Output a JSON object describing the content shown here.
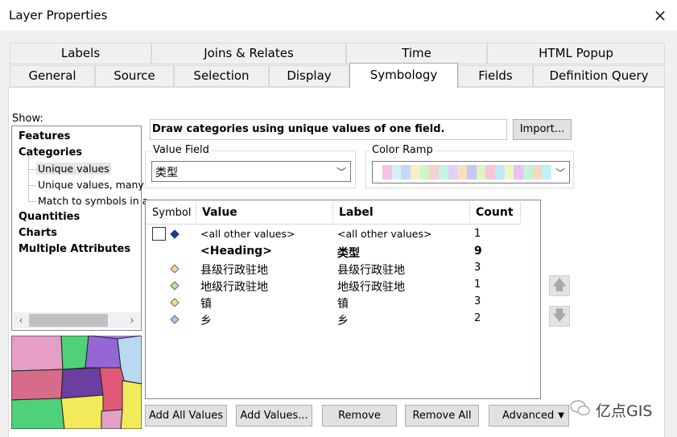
{
  "window": {
    "title": "Layer Properties",
    "close": "×"
  },
  "tabs_row1": [
    "Labels",
    "Joins & Relates",
    "Time",
    "HTML Popup"
  ],
  "tabs_row2": [
    "General",
    "Source",
    "Selection",
    "Display",
    "Symbology",
    "Fields",
    "Definition Query"
  ],
  "active_tab": "Symbology",
  "show": {
    "label": "Show:",
    "items": [
      {
        "text": "Features",
        "level": 0
      },
      {
        "text": "Categories",
        "level": 0
      },
      {
        "text": "Unique values",
        "level": 1,
        "selected": true
      },
      {
        "text": "Unique values, many",
        "level": 1
      },
      {
        "text": "Match to symbols in a",
        "level": 1
      },
      {
        "text": "Quantities",
        "level": 0
      },
      {
        "text": "Charts",
        "level": 0
      },
      {
        "text": "Multiple Attributes",
        "level": 0
      }
    ]
  },
  "description": "Draw categories using unique values of one field.",
  "import_label": "Import...",
  "value_field": {
    "label": "Value Field",
    "value": "类型"
  },
  "color_ramp": {
    "label": "Color Ramp",
    "swatches": [
      "#f5c2ea",
      "#d5f0f5",
      "#c7d8f5",
      "#f5f0c7",
      "#d2f5c2",
      "#f5d0d0",
      "#c2f5e3",
      "#e0d0f5",
      "#f5e1c2",
      "#c7c7f5",
      "#ddf5c2",
      "#f5c7d8",
      "#c2e8f5",
      "#f0f5c2",
      "#e8c2f5",
      "#c2f5d2",
      "#f5d8c2",
      "#c2f0f5"
    ]
  },
  "table": {
    "headers": {
      "symbol": "Symbol",
      "value": "Value",
      "label": "Label",
      "count": "Count"
    },
    "rows": [
      {
        "kind": "all",
        "value": "<all other values>",
        "label": "<all other values>",
        "count": "1",
        "color": "#1f3a93"
      },
      {
        "kind": "heading",
        "value": "<Heading>",
        "label": "类型",
        "count": "9"
      },
      {
        "kind": "item",
        "value": "县级行政驻地",
        "label": "县级行政驻地",
        "count": "3",
        "color": "#f0d6a0"
      },
      {
        "kind": "item",
        "value": "地级行政驻地",
        "label": "地级行政驻地",
        "count": "1",
        "color": "#b9e3a8"
      },
      {
        "kind": "item",
        "value": "镇",
        "label": "镇",
        "count": "3",
        "color": "#f2e48a"
      },
      {
        "kind": "item",
        "value": "乡",
        "label": "乡",
        "count": "2",
        "color": "#a8c8f0"
      }
    ]
  },
  "buttons": {
    "add_all": "Add All Values",
    "add_values": "Add Values...",
    "remove": "Remove",
    "remove_all": "Remove All",
    "advanced": "Advanced"
  },
  "watermark": "亿点GIS",
  "icons": {
    "up": "arrow-up-icon",
    "down": "arrow-down-icon"
  }
}
